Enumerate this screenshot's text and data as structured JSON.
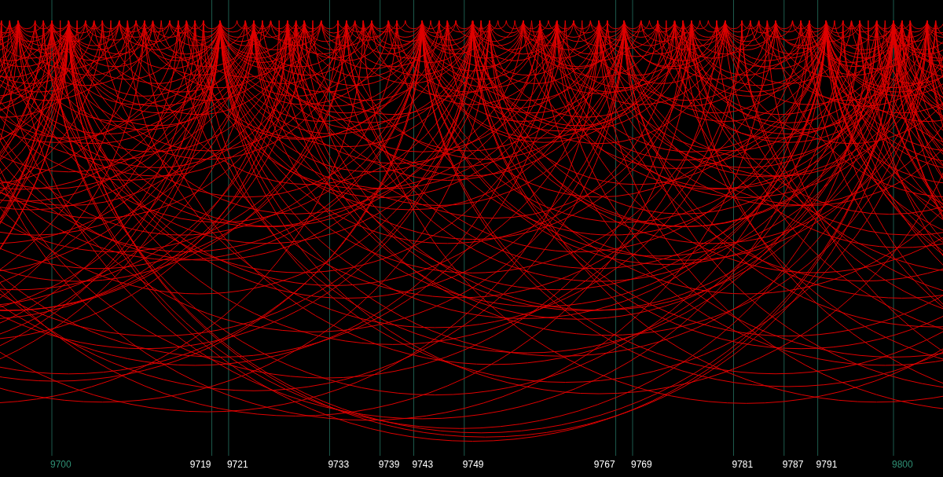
{
  "axis_labels": [
    {
      "text": "9700",
      "kind": "round"
    },
    {
      "text": "9719",
      "kind": "prime"
    },
    {
      "text": "9721",
      "kind": "prime"
    },
    {
      "text": "9733",
      "kind": "prime"
    },
    {
      "text": "9739",
      "kind": "prime"
    },
    {
      "text": "9743",
      "kind": "prime"
    },
    {
      "text": "9749",
      "kind": "prime"
    },
    {
      "text": "9767",
      "kind": "prime"
    },
    {
      "text": "9769",
      "kind": "prime"
    },
    {
      "text": "9781",
      "kind": "prime"
    },
    {
      "text": "9787",
      "kind": "prime"
    },
    {
      "text": "9791",
      "kind": "prime"
    },
    {
      "text": "9800",
      "kind": "round"
    }
  ]
}
